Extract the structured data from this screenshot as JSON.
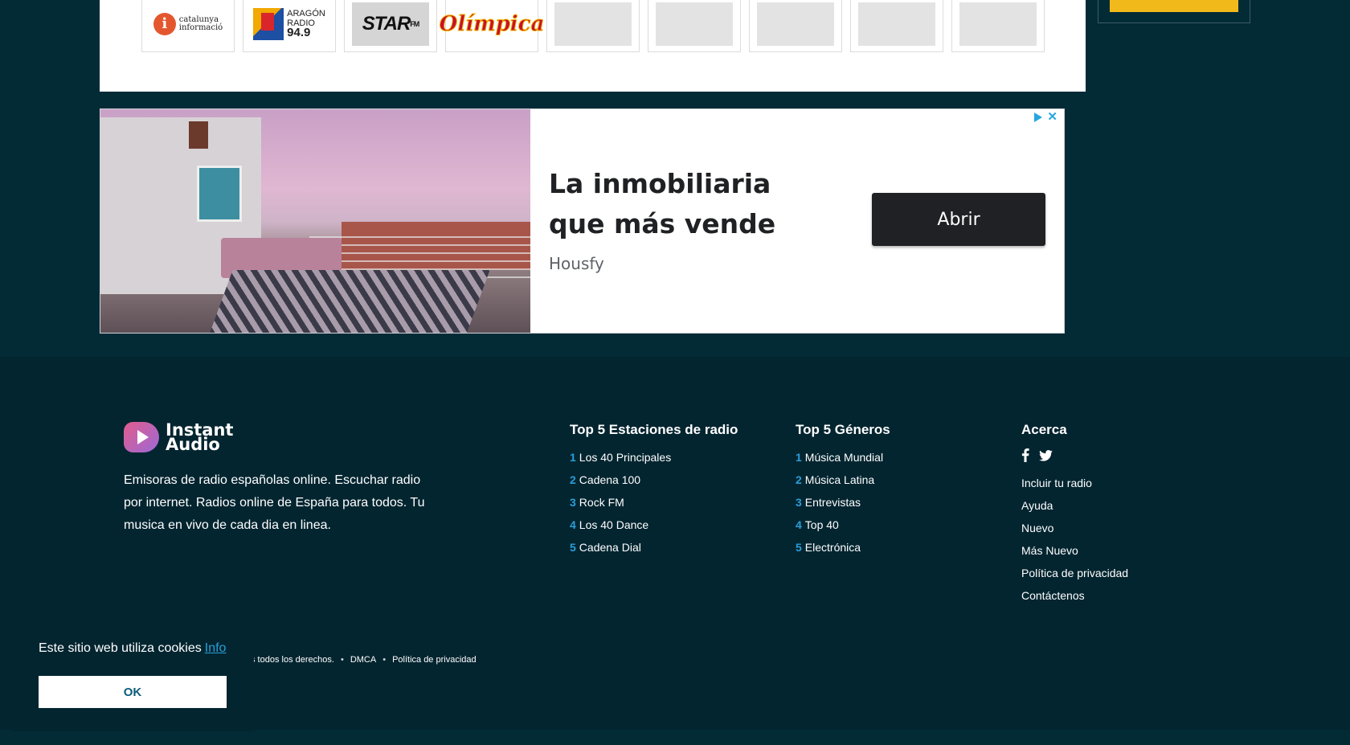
{
  "logos": [
    {
      "name": "catalunya-informacio",
      "line1": "catalunya",
      "line2": "informació"
    },
    {
      "name": "aragon-radio",
      "line1": "ARAGÓN",
      "line2": "RADIO",
      "line3": "94.9"
    },
    {
      "name": "mega-star-fm",
      "main": "STAR",
      "sub": "FM"
    },
    {
      "name": "olimpica",
      "main": "Olímpica"
    }
  ],
  "ad": {
    "title": "La inmobiliaria que más vende",
    "brand": "Housfy",
    "button": "Abrir"
  },
  "footer": {
    "brand_line1": "Instant",
    "brand_line2": "Audio",
    "description": "Emisoras de radio españolas online. Escuchar radio por internet. Radios online de España para todos. Tu musica en vivo de cada dia en linea.",
    "stations_title": "Top 5 Estaciones de radio",
    "stations": [
      {
        "num": "1",
        "label": "Los 40 Principales"
      },
      {
        "num": "2",
        "label": "Cadena 100"
      },
      {
        "num": "3",
        "label": "Rock FM"
      },
      {
        "num": "4",
        "label": "Los 40 Dance"
      },
      {
        "num": "5",
        "label": "Cadena Dial"
      }
    ],
    "genres_title": "Top 5 Géneros",
    "genres": [
      {
        "num": "1",
        "label": "Música Mundial"
      },
      {
        "num": "2",
        "label": "Música Latina"
      },
      {
        "num": "3",
        "label": "Entrevistas"
      },
      {
        "num": "4",
        "label": "Top 40"
      },
      {
        "num": "5",
        "label": "Electrónica"
      }
    ],
    "about_title": "Acerca",
    "about_links": [
      "Incluir tu radio",
      "Ayuda",
      "Nuevo",
      "Más Nuevo",
      "Política de privacidad",
      "Contáctenos"
    ],
    "social_icons": [
      "facebook-icon",
      "twitter-icon"
    ],
    "copyright": "s todos los derechos.",
    "dmca": "DMCA",
    "privacy": "Política de privacidad"
  },
  "cookie": {
    "text": "Este sitio web utiliza cookies",
    "info": "Info",
    "ok": "OK"
  },
  "colors": {
    "background": "#032b36",
    "footer": "#032530",
    "accent": "#2a9ed9",
    "ad_button": "#202124"
  }
}
